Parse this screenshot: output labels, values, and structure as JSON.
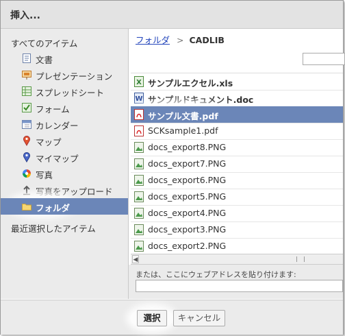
{
  "dialog": {
    "title": "挿入..."
  },
  "sidebar": {
    "heading": "すべてのアイテム",
    "items": [
      {
        "label": "文書",
        "icon": "document-icon"
      },
      {
        "label": "プレゼンテーション",
        "icon": "presentation-icon"
      },
      {
        "label": "スプレッドシート",
        "icon": "spreadsheet-icon"
      },
      {
        "label": "フォーム",
        "icon": "form-icon"
      },
      {
        "label": "カレンダー",
        "icon": "calendar-icon"
      },
      {
        "label": "マップ",
        "icon": "map-pin-icon"
      },
      {
        "label": "マイマップ",
        "icon": "my-map-pin-icon"
      },
      {
        "label": "写真",
        "icon": "photo-icon"
      },
      {
        "label": "写真をアップロード",
        "icon": "upload-icon"
      },
      {
        "label": "フォルダ",
        "icon": "folder-icon",
        "selected": true
      }
    ],
    "recent": "最近選択したアイテム"
  },
  "breadcrumb": {
    "parent": "フォルダ",
    "separator": ">",
    "current": "CADLIB"
  },
  "files": [
    {
      "name": "サンプルエクセル.xls",
      "type": "xls",
      "bold": true
    },
    {
      "name": "サンプルドキュメント.doc",
      "type": "doc",
      "bold": true
    },
    {
      "name": "サンプル文書.pdf",
      "type": "pdf",
      "selected": true
    },
    {
      "name": "SCKsample1.pdf",
      "type": "pdf"
    },
    {
      "name": "docs_export8.PNG",
      "type": "png"
    },
    {
      "name": "docs_export7.PNG",
      "type": "png"
    },
    {
      "name": "docs_export6.PNG",
      "type": "png"
    },
    {
      "name": "docs_export5.PNG",
      "type": "png"
    },
    {
      "name": "docs_export4.PNG",
      "type": "png"
    },
    {
      "name": "docs_export3.PNG",
      "type": "png"
    },
    {
      "name": "docs_export2.PNG",
      "type": "png"
    }
  ],
  "url": {
    "label": "または、ここにウェブアドレスを貼り付けます:",
    "value": ""
  },
  "buttons": {
    "select": "選択",
    "cancel": "キャンセル"
  },
  "colors": {
    "selection": "#6b86b8",
    "link": "#2244bb",
    "panel": "#ebebeb"
  }
}
